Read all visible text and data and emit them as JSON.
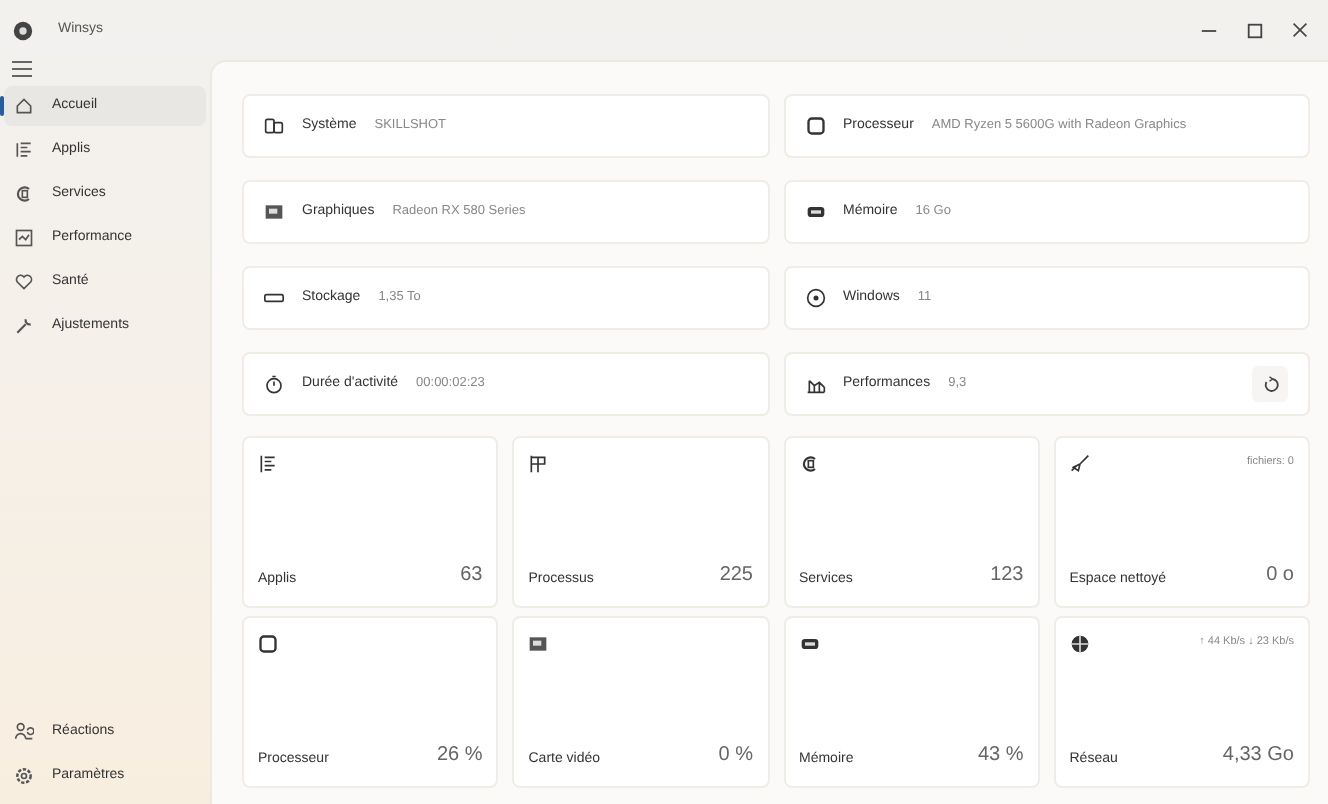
{
  "window": {
    "title": "Winsys"
  },
  "sidebar": {
    "items": [
      {
        "label": "Accueil",
        "selected": true
      },
      {
        "label": "Applis",
        "selected": false
      },
      {
        "label": "Services",
        "selected": false
      },
      {
        "label": "Performance",
        "selected": false
      },
      {
        "label": "Santé",
        "selected": false
      },
      {
        "label": "Ajustements",
        "selected": false
      }
    ],
    "footer_items": [
      {
        "label": "Réactions"
      },
      {
        "label": "Paramètres"
      }
    ]
  },
  "info_cards": [
    {
      "label": "Système",
      "value": "SKILLSHOT"
    },
    {
      "label": "Processeur",
      "value": "AMD Ryzen 5 5600G with Radeon Graphics"
    },
    {
      "label": "Graphiques",
      "value": "Radeon RX 580 Series"
    },
    {
      "label": "Mémoire",
      "value": "16 Go"
    },
    {
      "label": "Stockage",
      "value": "1,35 To"
    },
    {
      "label": "Windows",
      "value": "11"
    },
    {
      "label": "Durée d'activité",
      "value": "00:00:02:23"
    },
    {
      "label": "Performances",
      "value": "9,3"
    }
  ],
  "tiles": [
    {
      "label": "Applis",
      "value": "63"
    },
    {
      "label": "Processus",
      "value": "225"
    },
    {
      "label": "Services",
      "value": "123"
    },
    {
      "label": "Espace nettoyé",
      "value": "0 o",
      "detail": "fichiers: 0"
    },
    {
      "label": "Processeur",
      "value": "26 %"
    },
    {
      "label": "Carte vidéo",
      "value": "0 %"
    },
    {
      "label": "Mémoire",
      "value": "43 %"
    },
    {
      "label": "Réseau",
      "value": "4,33 Go",
      "detail": "↑ 44 Kb/s ↓ 23 Kb/s"
    }
  ]
}
